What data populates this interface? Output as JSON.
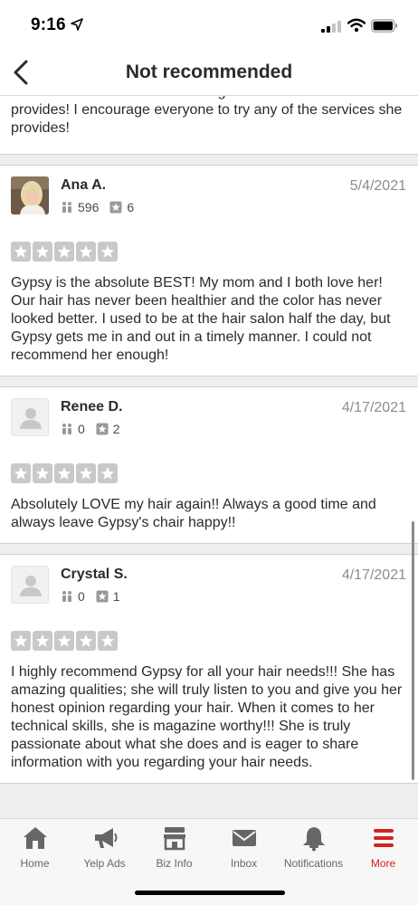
{
  "status_bar": {
    "time": "9:16"
  },
  "header": {
    "title": "Not recommended"
  },
  "partial_review": {
    "text": "describe her. I cannot rave enough of the service she provides! I encourage everyone to try any of the services she provides!"
  },
  "reviews": [
    {
      "name": "Ana A.",
      "date": "5/4/2021",
      "friends": "596",
      "reviews_count": "6",
      "rating": 5,
      "text": "Gypsy is the absolute BEST! My mom and I both love her! Our hair has never been healthier and the color has never looked better. I used to be at the hair salon half the day, but Gypsy gets me in and out in a timely manner. I could not recommend her enough!"
    },
    {
      "name": "Renee D.",
      "date": "4/17/2021",
      "friends": "0",
      "reviews_count": "2",
      "rating": 5,
      "text": "Absolutely LOVE my hair again!! Always a good time and always leave Gypsy's chair happy!!"
    },
    {
      "name": "Crystal S.",
      "date": "4/17/2021",
      "friends": "0",
      "reviews_count": "1",
      "rating": 5,
      "text": "I highly recommend Gypsy for all your hair needs!!! She has amazing qualities; she will truly listen to you and give you her honest opinion regarding your hair. When it comes to her technical skills, she is magazine worthy!!! She is truly passionate about what she does and is eager to share information with you regarding your hair needs."
    }
  ],
  "tabbar": {
    "items": [
      {
        "label": "Home",
        "icon": "home-icon"
      },
      {
        "label": "Yelp Ads",
        "icon": "megaphone-icon"
      },
      {
        "label": "Biz Info",
        "icon": "storefront-icon"
      },
      {
        "label": "Inbox",
        "icon": "envelope-icon"
      },
      {
        "label": "Notifications",
        "icon": "bell-icon"
      },
      {
        "label": "More",
        "icon": "menu-icon"
      }
    ],
    "active": "More"
  },
  "colors": {
    "accent": "#d32323",
    "star_inactive": "#c9c9c9",
    "date": "#8d8d8d"
  }
}
